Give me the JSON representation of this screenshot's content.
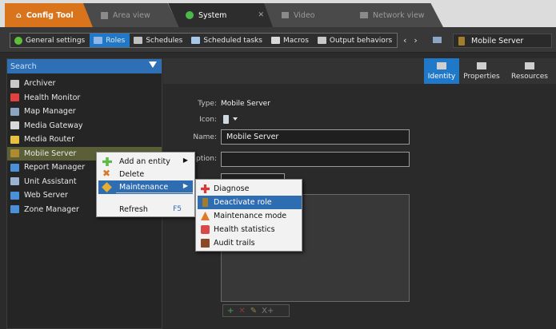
{
  "tabs": [
    {
      "label": "Config Tool"
    },
    {
      "label": "Area view"
    },
    {
      "label": "System",
      "close": "✕"
    },
    {
      "label": "Video"
    },
    {
      "label": "Network view"
    }
  ],
  "toolbar": {
    "items": [
      {
        "label": "General settings",
        "icon": "gear-icon",
        "color": "#5fbf3a"
      },
      {
        "label": "Roles",
        "icon": "roles-icon",
        "color": "#8fb8e8",
        "active": true
      },
      {
        "label": "Schedules",
        "icon": "calendar-icon",
        "color": "#c0c0c0"
      },
      {
        "label": "Scheduled tasks",
        "icon": "tasks-icon",
        "color": "#a8c8e8"
      },
      {
        "label": "Macros",
        "icon": "macro-icon",
        "color": "#d8d8d8"
      },
      {
        "label": "Output behaviors",
        "icon": "output-icon",
        "color": "#c8c8c8"
      }
    ],
    "back": "‹",
    "forward": "›",
    "current_entity": "Mobile Server"
  },
  "search": {
    "placeholder": "Search"
  },
  "tree": [
    {
      "label": "Archiver",
      "color": "#c8c8c8"
    },
    {
      "label": "Health Monitor",
      "color": "#e04040"
    },
    {
      "label": "Map Manager",
      "color": "#8aa6c4"
    },
    {
      "label": "Media Gateway",
      "color": "#d8d8d8"
    },
    {
      "label": "Media Router",
      "color": "#e8c040"
    },
    {
      "label": "Mobile Server",
      "color": "#b08a30",
      "selected": true
    },
    {
      "label": "Report Manager",
      "color": "#4a90d8"
    },
    {
      "label": "Unit Assistant",
      "color": "#9ab4d0"
    },
    {
      "label": "Web Server",
      "color": "#4a90d8"
    },
    {
      "label": "Zone Manager",
      "color": "#4a90d8"
    }
  ],
  "view_tabs": [
    {
      "label": "Identity",
      "active": true
    },
    {
      "label": "Properties"
    },
    {
      "label": "Resources"
    }
  ],
  "identity": {
    "type_label": "Type:",
    "type_value": "Mobile Server",
    "icon_label": "Icon:",
    "name_label": "Name:",
    "name_value": "Mobile Server",
    "description_label": "ription:"
  },
  "context_menu": {
    "items": [
      {
        "label": "Add an entity",
        "icon": "add-icon",
        "arrow": "▶"
      },
      {
        "label": "Delete",
        "icon": "delete-icon"
      },
      {
        "label": "Maintenance",
        "icon": "maintenance-icon",
        "arrow": "▶",
        "highlighted": true
      },
      {
        "label": "Refresh",
        "shortcut": "F5"
      }
    ]
  },
  "submenu": {
    "items": [
      {
        "label": "Diagnose",
        "icon": "diagnose-icon"
      },
      {
        "label": "Deactivate role",
        "icon": "deactivate-icon",
        "highlighted": true
      },
      {
        "label": "Maintenance mode",
        "icon": "cone-icon"
      },
      {
        "label": "Health statistics",
        "icon": "health-icon"
      },
      {
        "label": "Audit trails",
        "icon": "audit-icon"
      }
    ]
  },
  "edit_buttons": [
    "+",
    "✕",
    "✎",
    "X+"
  ]
}
